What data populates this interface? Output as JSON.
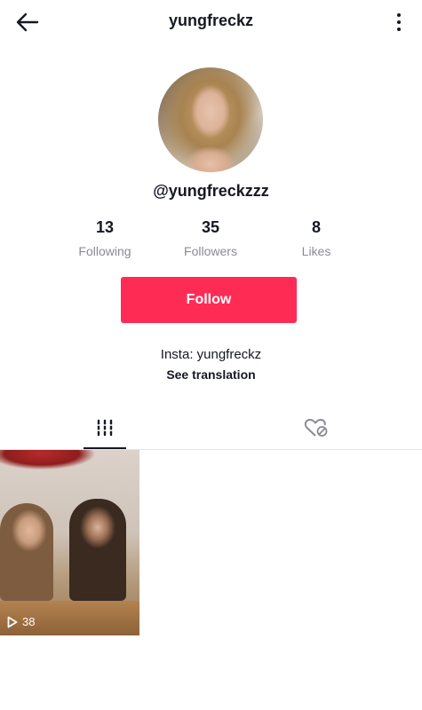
{
  "header": {
    "title": "yungfreckz",
    "back_icon": "arrow-left-icon",
    "more_icon": "more-vertical-icon"
  },
  "profile": {
    "handle": "@yungfreckzzz"
  },
  "stats": [
    {
      "value": "13",
      "label": "Following"
    },
    {
      "value": "35",
      "label": "Followers"
    },
    {
      "value": "8",
      "label": "Likes"
    }
  ],
  "actions": {
    "follow_label": "Follow"
  },
  "bio": {
    "text": "Insta: yungfreckz",
    "see_translation": "See translation"
  },
  "tabs": [
    {
      "icon": "grid-icon",
      "active": true
    },
    {
      "icon": "liked-videos-icon",
      "active": false
    }
  ],
  "videos": [
    {
      "play_count": "38"
    }
  ],
  "colors": {
    "accent": "#fe2c55",
    "text": "#161823",
    "muted": "#8a8b91"
  }
}
